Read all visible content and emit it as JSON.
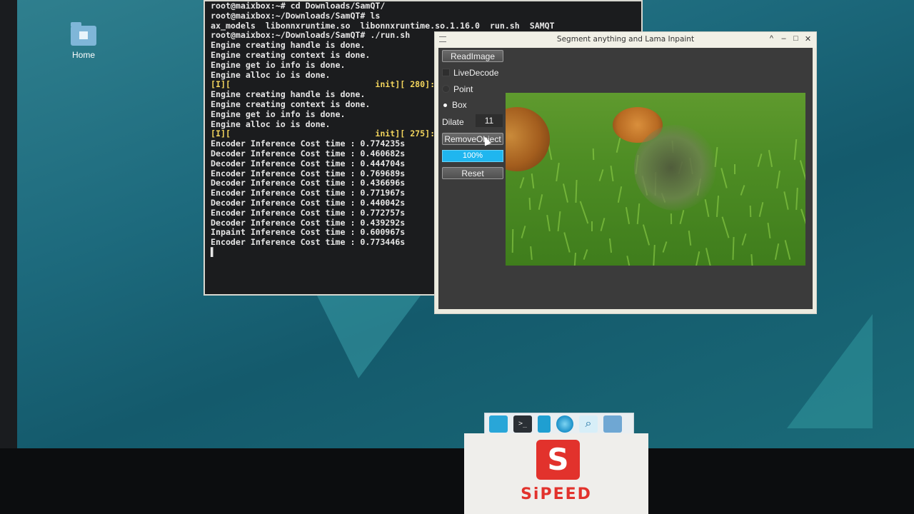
{
  "desktop": {
    "home_label": "Home"
  },
  "terminal": {
    "lines": [
      "root@maixbox:~# cd Downloads/SamQT/",
      "root@maixbox:~/Downloads/SamQT# ls",
      "ax_models  libonnxruntime.so  libonnxruntime.so.1.16.0  run.sh  SAMQT",
      "root@maixbox:~/Downloads/SamQT# ./run.sh",
      "Engine creating handle is done.",
      "Engine creating context is done.",
      "Engine get io info is done.",
      "Engine alloc io is done.",
      "[I][                             init][ 280]:",
      "Engine creating handle is done.",
      "Engine creating context is done.",
      "Engine get io info is done.",
      "Engine alloc io is done.",
      "[I][                             init][ 275]:",
      "Encoder Inference Cost time : 0.774235s",
      "Decoder Inference Cost time : 0.460682s",
      "Decoder Inference Cost time : 0.444704s",
      "Encoder Inference Cost time : 0.769689s",
      "Decoder Inference Cost time : 0.436696s",
      "Encoder Inference Cost time : 0.771967s",
      "Decoder Inference Cost time : 0.440042s",
      "Encoder Inference Cost time : 0.772757s",
      "Decoder Inference Cost time : 0.439292s",
      "Inpaint Inference Cost time : 0.600967s",
      "Encoder Inference Cost time : 0.773446s",
      "▌"
    ]
  },
  "app": {
    "title": "Segment anything and Lama Inpaint",
    "read_image_label": "ReadImage",
    "live_decode_label": "LiveDecode",
    "point_label": "Point",
    "box_label": "Box",
    "selected_mode": "Box",
    "dilate_label": "Dilate",
    "dilate_value": "11",
    "remove_object_label": "RemoveObject",
    "progress_text": "100%",
    "progress": 1.0,
    "reset_label": "Reset"
  },
  "dock": {
    "items": [
      "desktop-icon",
      "terminal-icon",
      "files-icon",
      "browser-icon",
      "search-icon",
      "folder-icon"
    ]
  },
  "badge": {
    "brand": "SiPEED",
    "logo_letter": "S"
  }
}
